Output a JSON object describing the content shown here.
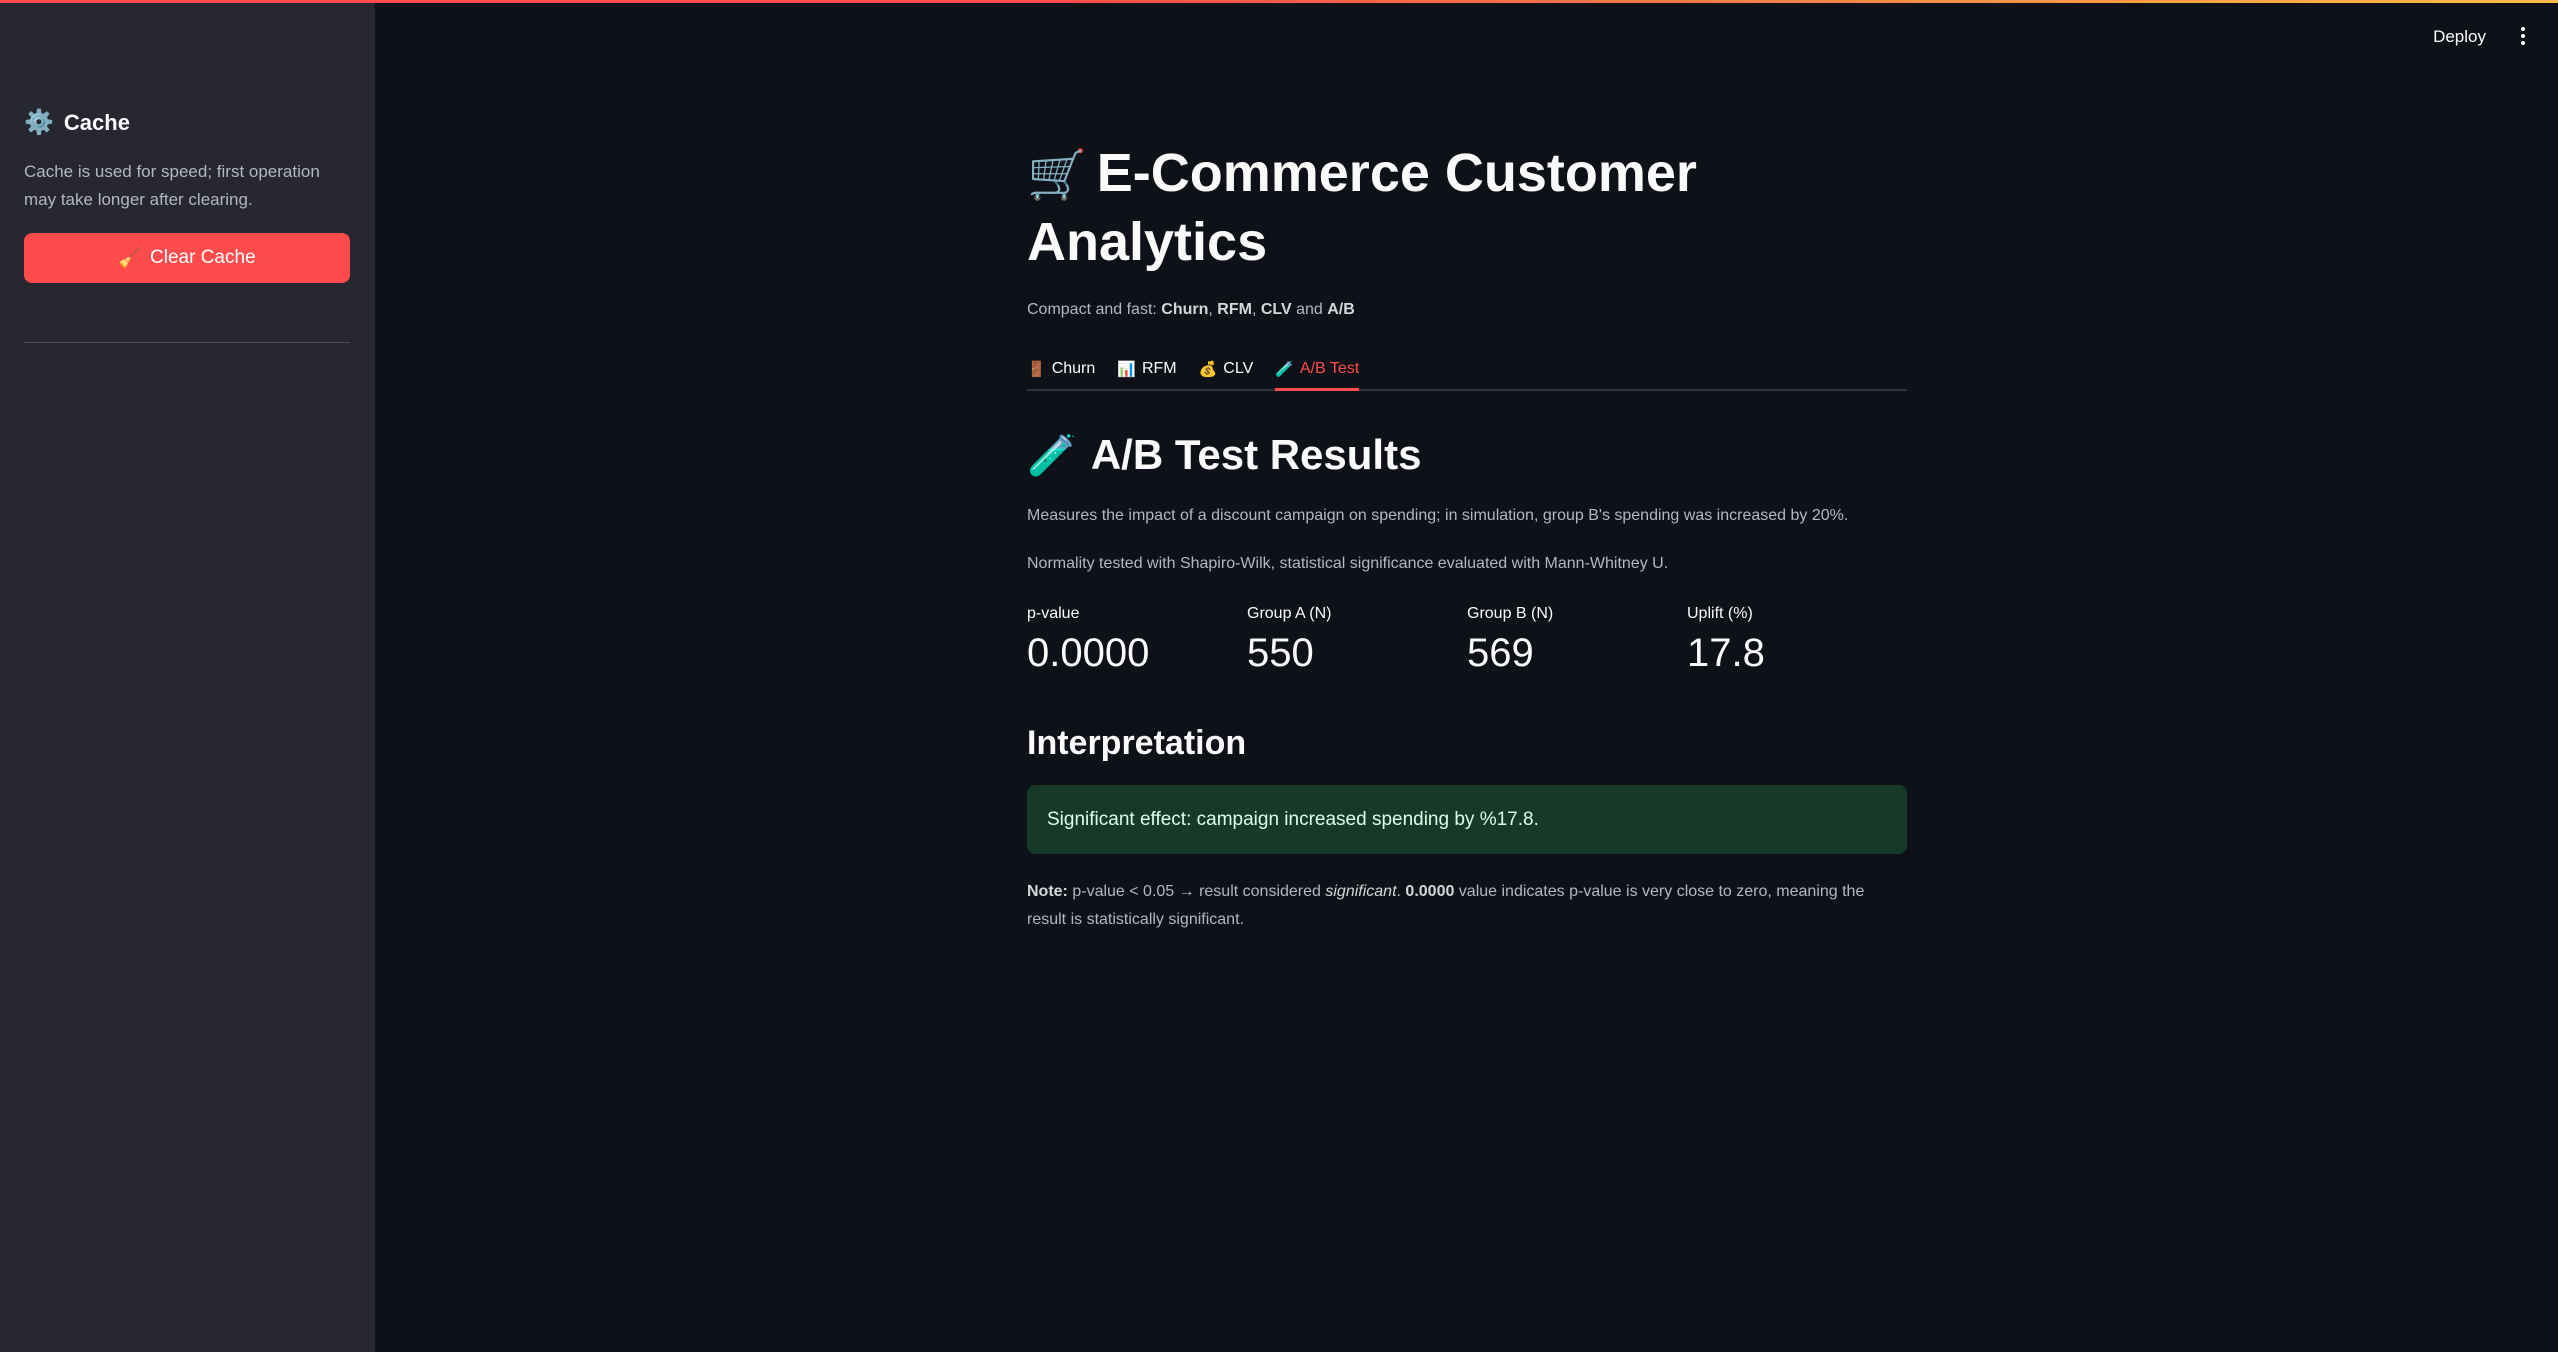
{
  "app": {
    "deploy_label": "Deploy"
  },
  "sidebar": {
    "gear_icon": "⚙️",
    "header": "Cache",
    "caption": "Cache is used for speed; first operation may take longer after clearing.",
    "clear_button": {
      "icon": "🧹",
      "label": "Clear Cache"
    }
  },
  "main": {
    "title_icon": "🛒",
    "title": "E-Commerce Customer Analytics",
    "subtitle": {
      "prefix": "Compact and fast: ",
      "items": [
        "Churn",
        "RFM",
        "CLV"
      ],
      "sep1": ", ",
      "sep2": ", ",
      "and": " and ",
      "last": "A/B"
    },
    "tabs": [
      {
        "icon": "🚪",
        "label": "Churn",
        "active": false
      },
      {
        "icon": "📊",
        "label": "RFM",
        "active": false
      },
      {
        "icon": "💰",
        "label": "CLV",
        "active": false
      },
      {
        "icon": "🧪",
        "label": "A/B Test",
        "active": true
      }
    ],
    "section": {
      "icon": "🧪",
      "title": "A/B Test Results",
      "description": "Measures the impact of a discount campaign on spending; in simulation, group B's spending was increased by 20%.",
      "method": "Normality tested with Shapiro-Wilk, statistical significance evaluated with Mann-Whitney U."
    },
    "metrics": [
      {
        "label": "p-value",
        "value": "0.0000"
      },
      {
        "label": "Group A (N)",
        "value": "550"
      },
      {
        "label": "Group B (N)",
        "value": "569"
      },
      {
        "label": "Uplift (%)",
        "value": "17.8"
      }
    ],
    "interpretation": {
      "title": "Interpretation",
      "alert": "Significant effect: campaign increased spending by %17.8."
    },
    "note": {
      "bold_label": "Note:",
      "text1": " p-value < 0.05 → result considered ",
      "italic": "significant",
      "text2": ". ",
      "bold_value": "0.0000",
      "text3": " value indicates p-value is very close to zero, meaning the result is statistically significant."
    }
  },
  "colors": {
    "accent": "#ff4b4b",
    "background": "#0e1117",
    "sidebar": "#262730",
    "success_bg": "#173928"
  }
}
